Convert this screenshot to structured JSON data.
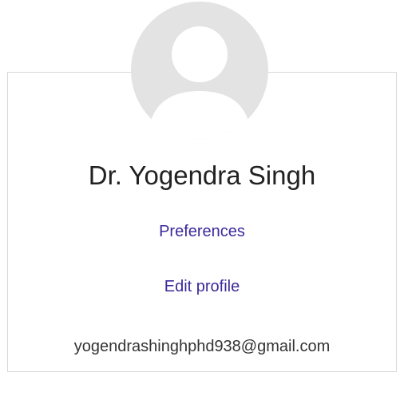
{
  "profile": {
    "avatar_icon": "user-avatar-placeholder-icon",
    "name": "Dr. Yogendra Singh",
    "preferences_label": "Preferences",
    "edit_profile_label": "Edit profile",
    "email": "yogendrashinghphd938@gmail.com"
  },
  "colors": {
    "link": "#3b2a9a",
    "text": "#222222",
    "border": "#d9d9d9",
    "avatar": "#e3e3e3"
  }
}
